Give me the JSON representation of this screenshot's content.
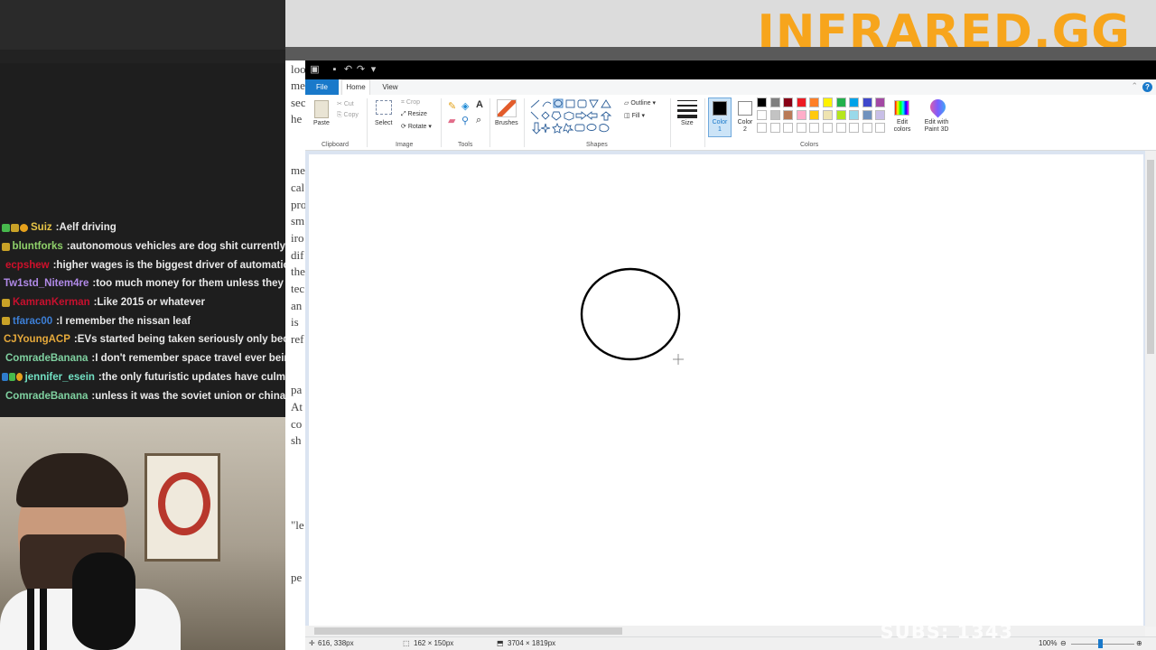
{
  "overlay": {
    "brand": "INFRARED.GG",
    "subs": "SUBS: 1343"
  },
  "chat": {
    "messages": [
      {
        "user": "Suiz",
        "user_color": "#e8c547",
        "text": "Aelf driving",
        "badges": [
          "g",
          "y",
          "o"
        ]
      },
      {
        "user": "bluntforks",
        "user_color": "#8fd16a",
        "text": "autonomous vehicles are dog shit currently",
        "badges": [
          "y"
        ]
      },
      {
        "user": "ecpshew",
        "user_color": "#d0102b",
        "text": "higher wages is the biggest driver of automation",
        "badges": [
          "r",
          "y"
        ]
      },
      {
        "user": "Tw1std_Nitem4re",
        "user_color": "#b18ae8",
        "text": "too much money for them unless they get",
        "badges": []
      },
      {
        "user": "KamranKerman",
        "user_color": "#c8102e",
        "text": "Like 2015 or whatever",
        "badges": [
          "y"
        ]
      },
      {
        "user": "tfarac00",
        "user_color": "#3d7fd6",
        "text": "I remember the nissan leaf",
        "badges": [
          "y"
        ]
      },
      {
        "user": "CJYoungACP",
        "user_color": "#e5a93b",
        "text": "EVs started being taken seriously only because",
        "badges": []
      },
      {
        "user": "ComradeBanana",
        "user_color": "#7fd1a0",
        "text": "I don't remember space travel ever bein",
        "badges": [
          "p",
          "y"
        ]
      },
      {
        "user": "jennifer_esein",
        "user_color": "#72e0c3",
        "text": "the only futuristic updates have culm",
        "badges": [
          "b",
          "g",
          "o"
        ]
      },
      {
        "user": "ComradeBanana",
        "user_color": "#7fd1a0",
        "text": "unless it was the soviet union or china",
        "badges": [
          "p",
          "y"
        ]
      }
    ]
  },
  "background_doc": {
    "fragments": [
      "loo",
      "me",
      "sec",
      "he",
      "me",
      "cal",
      "pro",
      "sm",
      "iro",
      "dif",
      "the",
      "tec",
      "an",
      "is",
      "ref",
      "pa",
      "At",
      "co",
      "sh",
      "\"le",
      "pe"
    ]
  },
  "paint": {
    "menu": {
      "file": "File",
      "home": "Home",
      "view": "View"
    },
    "clipboard": {
      "paste": "Paste",
      "cut": "Cut",
      "copy": "Copy",
      "group": "Clipboard"
    },
    "image": {
      "select": "Select",
      "crop": "Crop",
      "resize": "Resize",
      "rotate": "Rotate",
      "group": "Image"
    },
    "tools": {
      "group": "Tools",
      "text": "A"
    },
    "brushes": {
      "label": "Brushes"
    },
    "shapes": {
      "outline": "Outline",
      "fill": "Fill",
      "group": "Shapes"
    },
    "size": {
      "label": "Size"
    },
    "colors": {
      "color1": "Color 1",
      "color2": "Color 2",
      "edit": "Edit colors",
      "paint3d": "Edit with Paint 3D",
      "group": "Colors",
      "palette_row1": [
        "#000000",
        "#7f7f7f",
        "#880015",
        "#ed1c24",
        "#ff7f27",
        "#fff200",
        "#22b14c",
        "#00a2e8",
        "#3f48cc",
        "#a349a4"
      ],
      "palette_row2": [
        "#ffffff",
        "#c3c3c3",
        "#b97a57",
        "#ffaec9",
        "#ffc90e",
        "#efe4b0",
        "#b5e61d",
        "#99d9ea",
        "#7092be",
        "#c8bfe7"
      ]
    },
    "status": {
      "cursor_pos": "616, 338px",
      "selection_size": "162 × 150px",
      "canvas_size": "3704 × 1819px",
      "zoom": "100%"
    }
  }
}
